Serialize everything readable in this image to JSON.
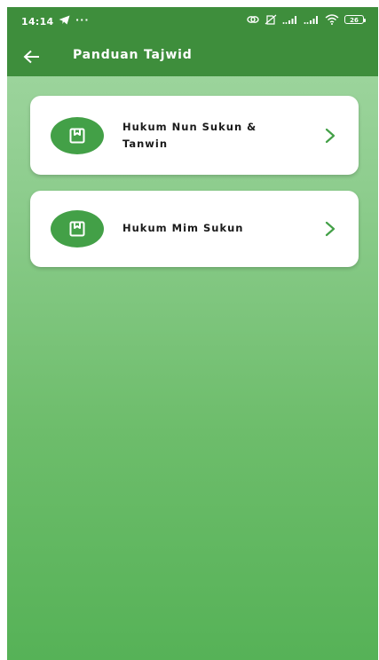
{
  "status_bar": {
    "time": "14:14",
    "more": "···",
    "battery": "26"
  },
  "toolbar": {
    "title": "Panduan Tajwid"
  },
  "cards": [
    {
      "label": "Hukum Nun Sukun & Tanwin"
    },
    {
      "label": "Hukum Mim Sukun"
    }
  ],
  "colors": {
    "appbar": "#3e8e3c",
    "icon_circle": "#43a047",
    "chevron": "#43a047",
    "background_top": "#a4d8a4",
    "background_bottom": "#56b257"
  },
  "icons": {
    "back": "arrow-left-icon",
    "card": "book-icon",
    "chevron": "chevron-right-icon"
  }
}
